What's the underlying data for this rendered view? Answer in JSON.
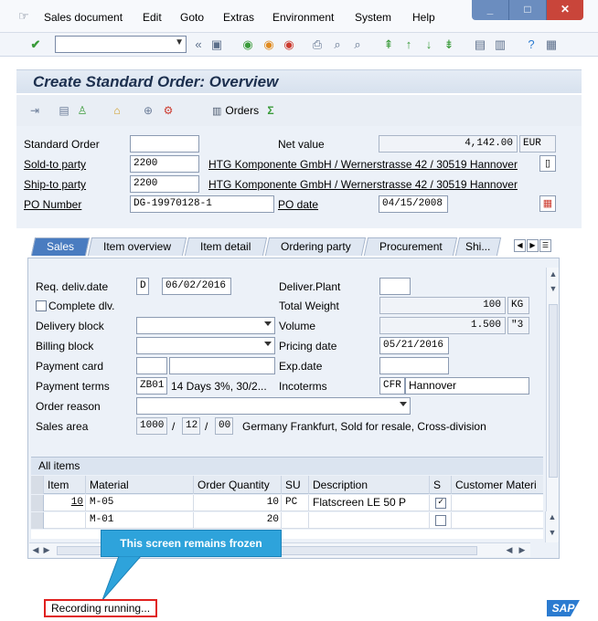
{
  "menu": {
    "items": [
      "Sales document",
      "Edit",
      "Goto",
      "Extras",
      "Environment",
      "System",
      "Help"
    ]
  },
  "window_controls": {
    "minimize": "_",
    "maximize": "□",
    "close": "✕"
  },
  "standard_toolbar": {
    "icons": [
      "enter-icon",
      "save-icon",
      "back-icon",
      "exit-icon",
      "cancel-icon",
      "print-icon",
      "find-icon",
      "find-next-icon",
      "first-page-icon",
      "prev-page-icon",
      "next-page-icon",
      "last-page-icon",
      "new-session-icon",
      "shortcut-icon",
      "help-icon",
      "layout-icon"
    ]
  },
  "title": "Create Standard Order: Overview",
  "app_toolbar": {
    "orders_label": "Orders"
  },
  "header": {
    "standard_order_label": "Standard Order",
    "standard_order_value": "",
    "net_value_label": "Net value",
    "net_value": "4,142.00",
    "currency": "EUR",
    "sold_to_label": "Sold-to party",
    "sold_to_value": "2200",
    "sold_to_text": "HTG Komponente GmbH / Wernerstrasse 42 / 30519 Hannover",
    "ship_to_label": "Ship-to party",
    "ship_to_value": "2200",
    "ship_to_text": "HTG Komponente GmbH / Wernerstrasse 42 / 30519 Hannover",
    "po_number_label": "PO Number",
    "po_number_value": "DG-19970128-1",
    "po_date_label": "PO date",
    "po_date_value": "04/15/2008"
  },
  "tabs": [
    {
      "label": "Sales",
      "active": true
    },
    {
      "label": "Item overview",
      "active": false
    },
    {
      "label": "Item detail",
      "active": false
    },
    {
      "label": "Ordering party",
      "active": false
    },
    {
      "label": "Procurement",
      "active": false
    },
    {
      "label": "Shi...",
      "active": false
    }
  ],
  "sales_tab": {
    "req_deliv_label": "Req. deliv.date",
    "req_deliv_type": "D",
    "req_deliv_value": "06/02/2016",
    "deliver_plant_label": "Deliver.Plant",
    "deliver_plant_value": "",
    "complete_dlv_label": "Complete dlv.",
    "complete_dlv_checked": false,
    "total_weight_label": "Total Weight",
    "total_weight_value": "100",
    "weight_unit": "KG",
    "delivery_block_label": "Delivery block",
    "volume_label": "Volume",
    "volume_value": "1.500",
    "volume_unit": "\"3",
    "billing_block_label": "Billing block",
    "pricing_date_label": "Pricing date",
    "pricing_date_value": "05/21/2016",
    "payment_card_label": "Payment card",
    "exp_date_label": "Exp.date",
    "payment_terms_label": "Payment terms",
    "payment_terms_code": "ZB01",
    "payment_terms_text": "14 Days 3%, 30/2...",
    "incoterms_label": "Incoterms",
    "incoterms_code": "CFR",
    "incoterms_text": "Hannover",
    "order_reason_label": "Order reason",
    "sales_area_label": "Sales area",
    "sales_org": "1000",
    "dist_channel": "12",
    "division": "00",
    "sales_area_text": "Germany Frankfurt, Sold for resale, Cross-division"
  },
  "items_table": {
    "title": "All items",
    "columns": [
      "Item",
      "Material",
      "Order Quantity",
      "SU",
      "Description",
      "S",
      "Customer Materi"
    ],
    "rows": [
      {
        "item": "10",
        "material": "M-05",
        "qty": "10",
        "su": "PC",
        "description": "Flatscreen LE 50 P",
        "checked": true
      },
      {
        "item": "",
        "material": "M-01",
        "qty": "20",
        "su": "",
        "description": "",
        "checked": false
      }
    ]
  },
  "callout": "This screen remains frozen",
  "status": "Recording running...",
  "logo": "SAP",
  "colors": {
    "active_tab": "#4a7cc0",
    "callout": "#2ea3db",
    "status_border": "#e0201e"
  }
}
